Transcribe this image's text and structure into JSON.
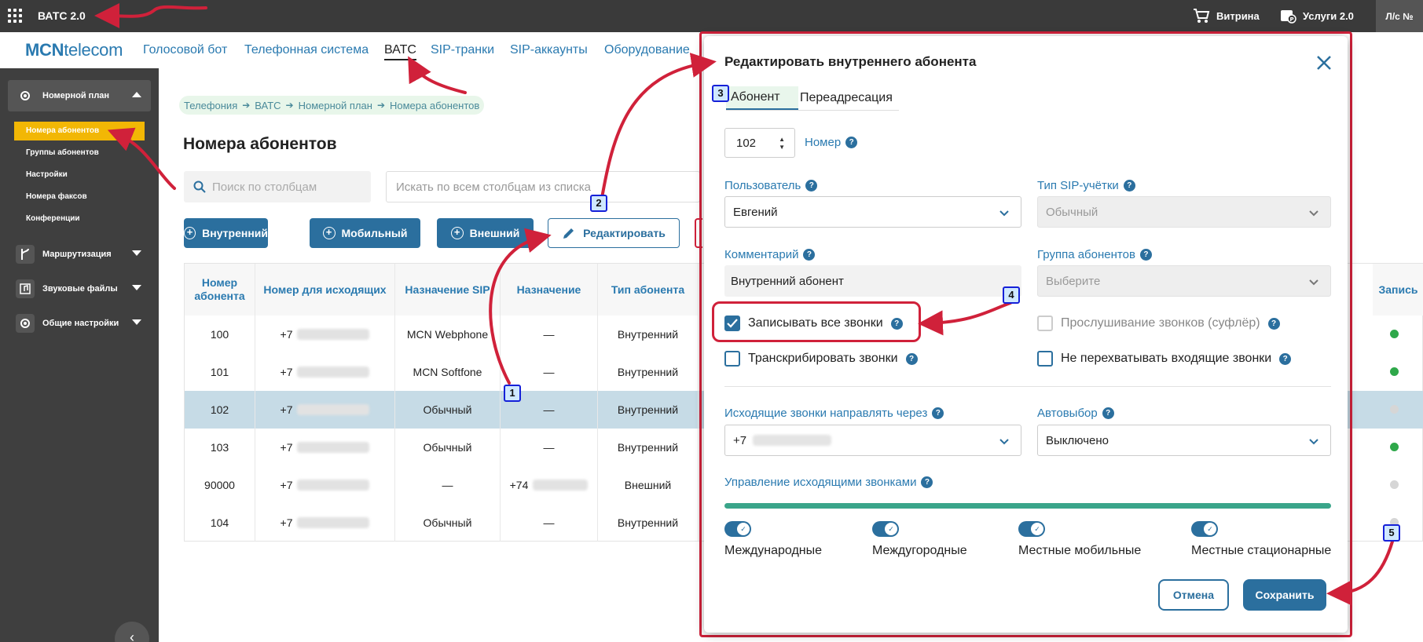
{
  "topbar": {
    "app_title": "ВАТС 2.0",
    "vitrina": "Витрина",
    "uslugi": "Услуги 2.0",
    "account": "Л/с №"
  },
  "navbar": {
    "logo_bold": "MCN",
    "logo_rest": "telecom",
    "items": [
      "Голосовой бот",
      "Телефонная система",
      "ВАТС",
      "SIP-транки",
      "SIP-аккаунты",
      "Оборудование"
    ]
  },
  "sidebar": {
    "group_numbering": "Номерной план",
    "sub_items": [
      "Номера абонентов",
      "Группы абонентов",
      "Настройки",
      "Номера факсов",
      "Конференции"
    ],
    "group_routing": "Маршрутизация",
    "group_sounds": "Звуковые файлы",
    "group_general": "Общие настройки"
  },
  "breadcrumb": [
    "Телефония",
    "ВАТС",
    "Номерной план",
    "Номера абонентов"
  ],
  "page_title": "Номера абонентов",
  "search": {
    "column_placeholder": "Поиск по столбцам",
    "all_placeholder": "Искать по всем столбцам из списка"
  },
  "actions": {
    "internal": "Внутренний",
    "mobile": "Мобильный",
    "external": "Внешний",
    "edit": "Редактировать"
  },
  "table": {
    "headers": [
      "Номер абонента",
      "Номер для исходящих",
      "Назначение SIP",
      "Назначение",
      "Тип абонента",
      "Запись"
    ],
    "rows": [
      {
        "num": "100",
        "out": "+7",
        "sip": "MCN Webphone",
        "dest": "—",
        "type": "Внутренний",
        "rec": "on"
      },
      {
        "num": "101",
        "out": "+7",
        "sip": "MCN Softfone",
        "dest": "—",
        "type": "Внутренний",
        "rec": "on"
      },
      {
        "num": "102",
        "out": "+7",
        "sip": "Обычный",
        "dest": "—",
        "type": "Внутренний",
        "rec": "off"
      },
      {
        "num": "103",
        "out": "+7",
        "sip": "Обычный",
        "dest": "—",
        "type": "Внутренний",
        "rec": "on"
      },
      {
        "num": "90000",
        "out": "+7",
        "sip": "—",
        "dest": "+74",
        "type": "Внешний",
        "rec": "off"
      },
      {
        "num": "104",
        "out": "+7",
        "sip": "Обычный",
        "dest": "—",
        "type": "Внутренний",
        "rec": "off"
      }
    ]
  },
  "modal": {
    "title": "Редактировать внутреннего абонента",
    "tab_subscriber": "Абонент",
    "tab_redirect": "Переадресация",
    "number_value": "102",
    "number_label": "Номер",
    "user_label": "Пользователь",
    "user_value": "Евгений",
    "sip_type_label": "Тип SIP-учётки",
    "sip_type_value": "Обычный",
    "comment_label": "Комментарий",
    "comment_value": "Внутренний абонент",
    "group_label": "Группа абонентов",
    "group_value": "Выберите",
    "record_all": "Записывать все звонки",
    "transcribe": "Транскрибировать звонки",
    "listen": "Прослушивание звонков (суфлёр)",
    "no_intercept": "Не перехватывать входящие звонки",
    "outgoing_via_label": "Исходящие звонки направлять через",
    "outgoing_via_value": "+7",
    "auto_label": "Автовыбор",
    "auto_value": "Выключено",
    "outgoing_mgmt_label": "Управление исходящими звонками",
    "toggles": [
      "Международные",
      "Междугородные",
      "Местные мобильные",
      "Местные стационарные"
    ],
    "cancel": "Отмена",
    "save": "Сохранить"
  },
  "markers": [
    "1",
    "2",
    "3",
    "4",
    "5"
  ],
  "colors": {
    "accent": "#2b6f9e",
    "sidebar_active": "#f2b705",
    "annotation_red": "#d0213a",
    "status_green": "#2ea84a",
    "status_grey": "#d6d6d6"
  }
}
